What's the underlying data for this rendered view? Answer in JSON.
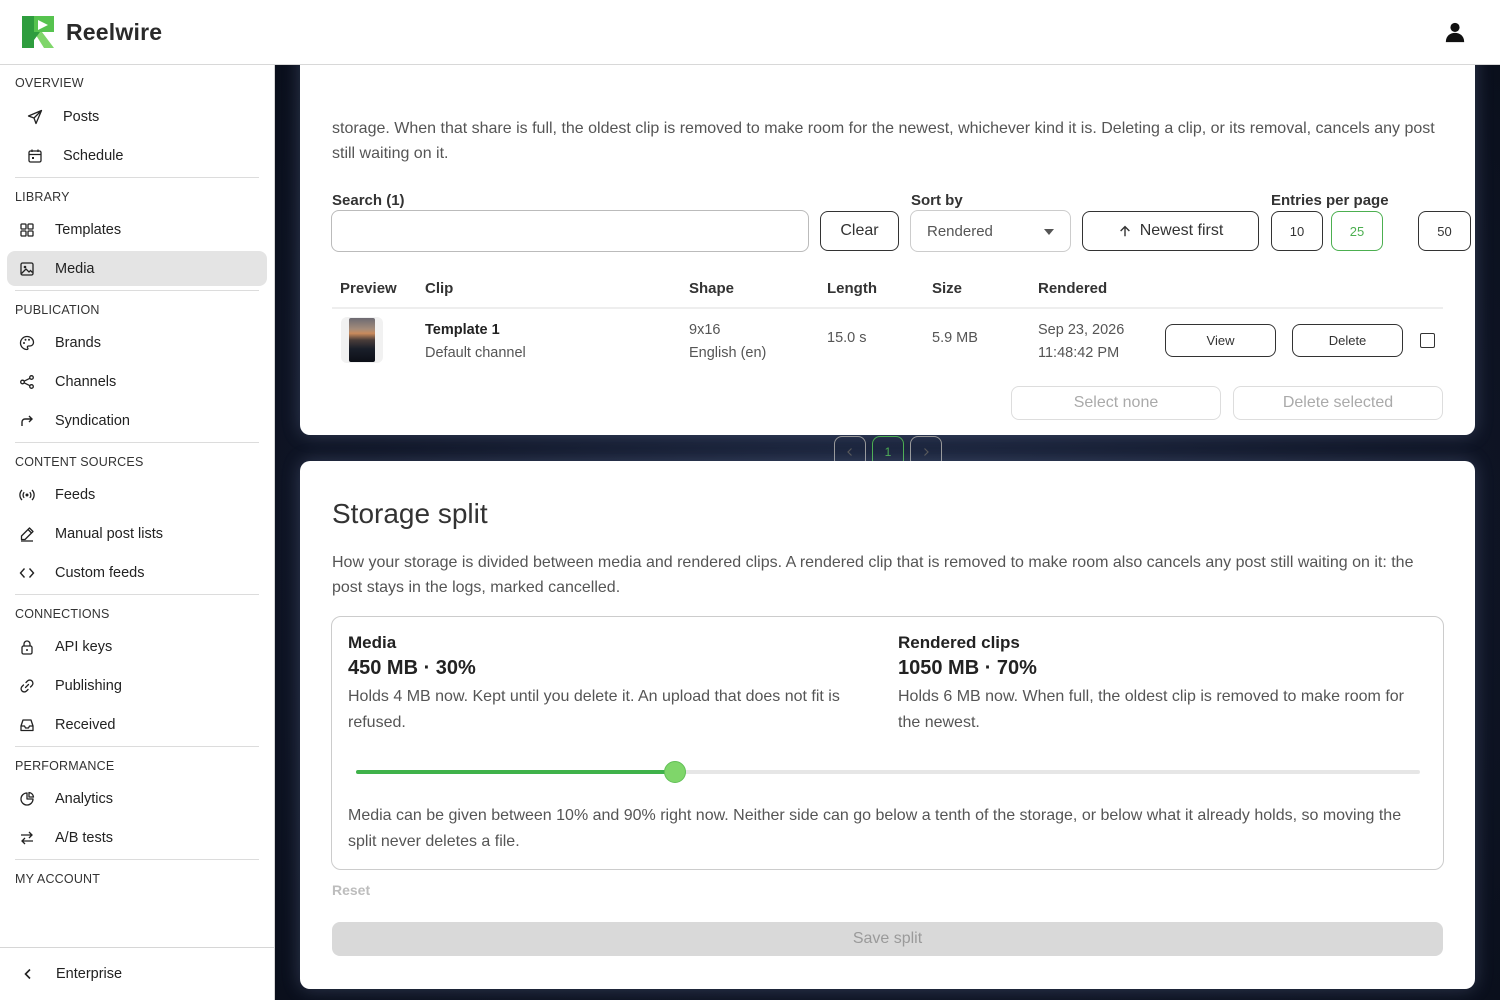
{
  "app": {
    "name": "Reelwire"
  },
  "sidebar": {
    "sections": [
      {
        "label": "OVERVIEW",
        "items": [
          {
            "label": "Posts",
            "icon": "send-icon"
          },
          {
            "label": "Schedule",
            "icon": "calendar-icon"
          }
        ]
      },
      {
        "label": "LIBRARY",
        "items": [
          {
            "label": "Templates",
            "icon": "grid-icon"
          },
          {
            "label": "Media",
            "icon": "image-icon",
            "active": true
          }
        ]
      },
      {
        "label": "PUBLICATION",
        "items": [
          {
            "label": "Brands",
            "icon": "palette-icon"
          },
          {
            "label": "Channels",
            "icon": "share-icon"
          },
          {
            "label": "Syndication",
            "icon": "forward-arrow-icon"
          }
        ]
      },
      {
        "label": "CONTENT SOURCES",
        "items": [
          {
            "label": "Feeds",
            "icon": "broadcast-icon"
          },
          {
            "label": "Manual post lists",
            "icon": "pencil-icon"
          },
          {
            "label": "Custom feeds",
            "icon": "code-icon"
          }
        ]
      },
      {
        "label": "CONNECTIONS",
        "items": [
          {
            "label": "API keys",
            "icon": "lock-icon"
          },
          {
            "label": "Publishing",
            "icon": "link-icon"
          },
          {
            "label": "Received",
            "icon": "inbox-icon"
          }
        ]
      },
      {
        "label": "PERFORMANCE",
        "items": [
          {
            "label": "Analytics",
            "icon": "pie-chart-icon"
          },
          {
            "label": "A/B tests",
            "icon": "swap-icon"
          }
        ]
      },
      {
        "label": "MY ACCOUNT",
        "items": []
      }
    ],
    "footer": {
      "label": "Enterprise"
    }
  },
  "clips": {
    "intro": "storage. When that share is full, the oldest clip is removed to make room for the newest, whichever kind it is. Deleting a clip, or its removal, cancels any post still waiting on it.",
    "search_label": "Search (1)",
    "search_value": "",
    "clear_label": "Clear",
    "sort_label": "Sort by",
    "sort_value": "Rendered",
    "order_label": "Newest first",
    "entries_label": "Entries per page",
    "entries_options": [
      "10",
      "25",
      "50"
    ],
    "entries_selected": "25",
    "columns": [
      "Preview",
      "Clip",
      "Shape",
      "Length",
      "Size",
      "Rendered"
    ],
    "rows": [
      {
        "clip": "Template 1",
        "channel": "Default channel",
        "shape": "9x16",
        "language": "English (en)",
        "length": "15.0 s",
        "size": "5.9 MB",
        "date": "Sep 23, 2026",
        "time": "11:48:42 PM",
        "view_label": "View",
        "delete_label": "Delete"
      }
    ],
    "select_none_label": "Select none",
    "delete_selected_label": "Delete selected",
    "pages": [
      "1"
    ],
    "current_page": "1"
  },
  "storage": {
    "title": "Storage split",
    "description": "How your storage is divided between media and rendered clips. A rendered clip that is removed to make room also cancels any post still waiting on it: the post stays in the logs, marked cancelled.",
    "media": {
      "name": "Media",
      "value": "450 MB · 30%",
      "desc": "Holds 4 MB now. Kept until you delete it. An upload that does not fit is refused."
    },
    "clips": {
      "name": "Rendered clips",
      "value": "1050 MB · 70%",
      "desc": "Holds 6 MB now. When full, the oldest clip is removed to make room for the newest."
    },
    "split_fraction": 0.3,
    "note": "Media can be given between 10% and 90% right now. Neither side can go below a tenth of the storage, or below what it already holds, so moving the split never deletes a file.",
    "reset_label": "Reset",
    "save_label": "Save split"
  },
  "colors": {
    "accent": "#4caf50",
    "slider_fill": "#3fb24a",
    "slider_knob": "#7fd66a",
    "main_bg": "#0f1526"
  }
}
